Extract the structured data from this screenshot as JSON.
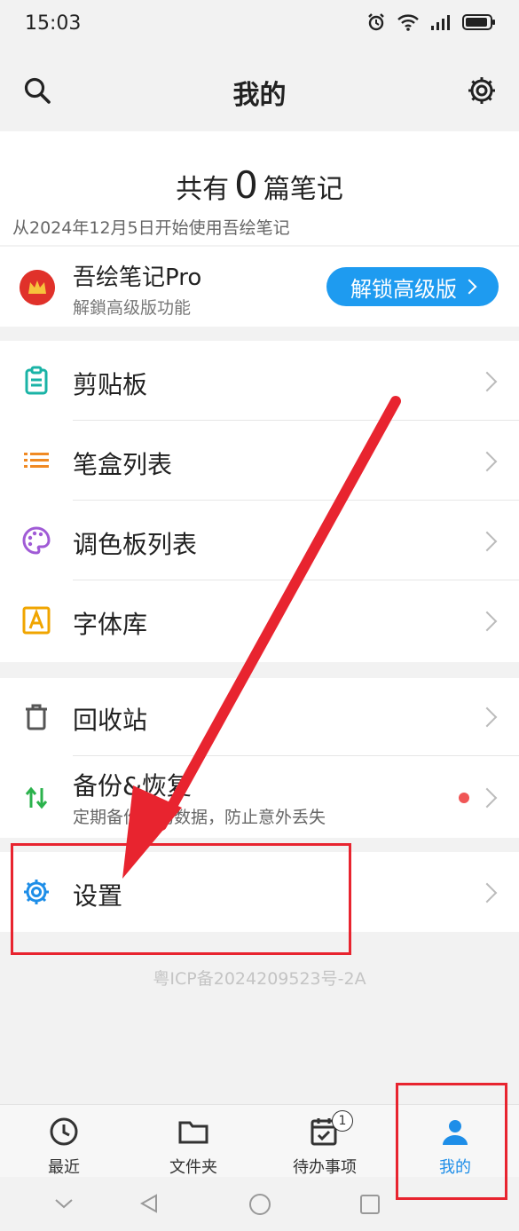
{
  "status_bar": {
    "time": "15:03"
  },
  "header": {
    "title": "我的"
  },
  "summary": {
    "prefix": "共有",
    "count": "0",
    "suffix": "篇笔记",
    "since": "从2024年12月5日开始使用吾绘笔记"
  },
  "pro": {
    "title": "吾绘笔记Pro",
    "subtitle": "解鎖高级版功能",
    "unlock_label": "解锁高级版"
  },
  "group1": [
    {
      "label": "剪贴板",
      "icon": "clipboard-icon",
      "color": "#1ab3a6"
    },
    {
      "label": "笔盒列表",
      "icon": "list-icon",
      "color": "#f08a24"
    },
    {
      "label": "调色板列表",
      "icon": "palette-icon",
      "color": "#a05bd6"
    },
    {
      "label": "字体库",
      "icon": "font-icon",
      "color": "#f0a500"
    }
  ],
  "group2": [
    {
      "label": "回收站",
      "icon": "trash-icon",
      "color": "#555555"
    },
    {
      "label": "备份&恢复",
      "subtitle": "定期备份你的数据，防止意外丢失",
      "icon": "sync-icon",
      "color": "#2bb24c"
    }
  ],
  "group3": [
    {
      "label": "设置",
      "icon": "gear-icon",
      "color": "#1e8ee8"
    }
  ],
  "icp": "粤ICP备2024209523号-2A",
  "bottom_nav": [
    {
      "label": "最近",
      "icon": "clock-icon"
    },
    {
      "label": "文件夹",
      "icon": "folder-icon"
    },
    {
      "label": "待办事项",
      "icon": "calendar-check-icon",
      "badge": "1"
    },
    {
      "label": "我的",
      "icon": "person-icon",
      "active": true
    }
  ],
  "colors": {
    "accent": "#1e9bf0",
    "annotation": "#e8242f"
  }
}
